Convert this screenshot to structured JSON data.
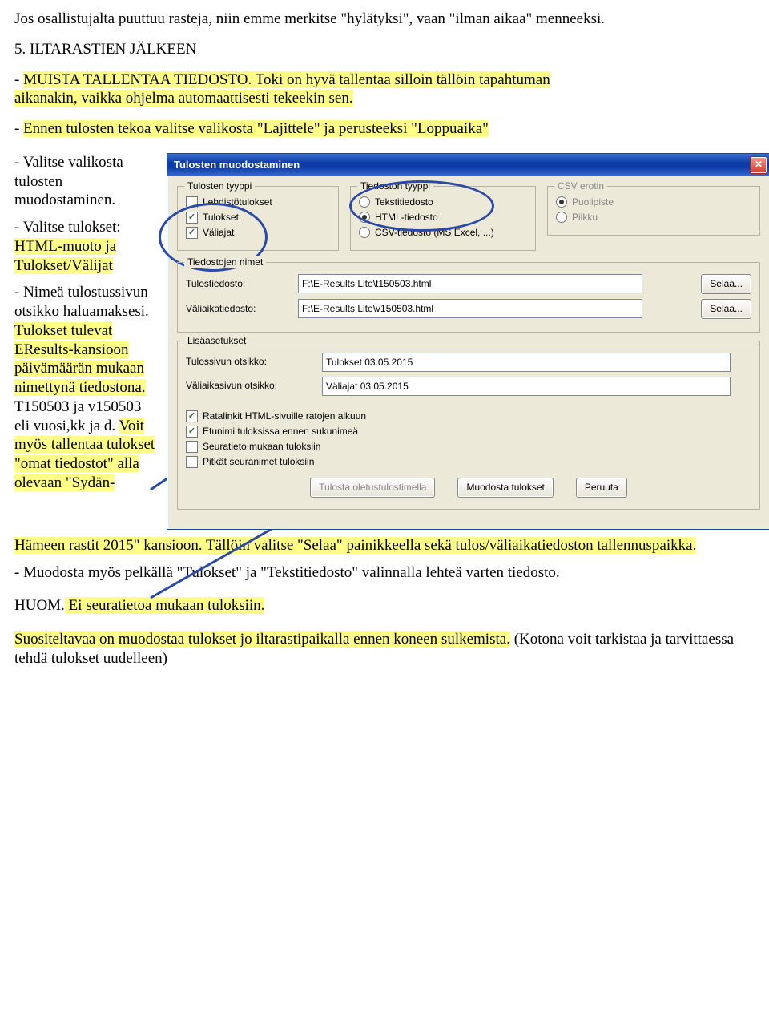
{
  "doc": {
    "intro": "Jos osallistujalta puuttuu rasteja, niin emme merkitse \"hylätyksi\", vaan \"ilman aikaa\" menneeksi.",
    "section_num": "5.  ILTARASTIEN JÄLKEEN",
    "muista_pre": "- ",
    "muista_hl": "MUISTA TALLENTAA TIEDOSTO.",
    "muista_post1_hl": " Toki on hyvä tallentaa silloin tällöin tapahtuman",
    "muista_line2_hl": "aikanakin, vaikka ohjelma automaattisesti tekeekin sen.",
    "ennen_pre": "-  ",
    "ennen_hl": "Ennen tulosten tekoa valitse valikosta \"Lajittele\" ja perusteeksi \"Loppuaika\"",
    "left": {
      "a1": "-  Valitse valikosta tulosten muodostaminen.",
      "b1_pre": "-  Valitse tulokset: ",
      "b1_hl": "HTML-muoto ja Tulokset/Välijat",
      "c_plain1": "-  Nimeä tulostussivun otsikko haluamaksesi. ",
      "c_hl1": "Tulokset tulevat EResults-kansioon päivämäärän mukaan nimettynä tiedostona.",
      "c_plain2": " T150503 ja v150503 eli vuosi,kk ja d. ",
      "c_hl2": "Voit myös tallentaa tulokset \"omat tiedostot\" alla olevaan \"Sydän-"
    },
    "after": {
      "cont_hl": "Hämeen rastit 2015\" kansioon. Tällöin valitse \"Selaa\" painikkeella sekä tulos/väliaikatiedoston tallennuspaikka.",
      "line2": "-  Muodosta myös pelkällä \"Tulokset\" ja \"Tekstitiedosto\" valinnalla lehteä varten tiedosto.",
      "huom_pre": "HUOM.",
      "huom_hl": "  Ei seuratietoa mukaan tuloksiin.",
      "suos_hl": "Suositeltavaa on muodostaa tulokset jo iltarastipaikalla ennen koneen sulkemista.",
      "suos_post": "   (Kotona voit tarkistaa ja tarvittaessa tehdä tulokset uudelleen)"
    }
  },
  "dialog": {
    "title": "Tulosten muodostaminen",
    "fs_tt": "Tulosten tyyppi",
    "tt_lehd": "Lehdistötulokset",
    "tt_tul": "Tulokset",
    "tt_vali": "Väliajat",
    "fs_td": "Tiedoston tyyppi",
    "td_teksti": "Tekstitiedosto",
    "td_html": "HTML-tiedosto",
    "td_csv": "CSV-tiedosto (MS Excel, ...)",
    "fs_csv": "CSV erotin",
    "csv_pp": "Puolipiste",
    "csv_pk": "Pilkku",
    "fs_names": "Tiedostojen nimet",
    "lbl_tulos": "Tulostiedosto:",
    "val_tulos": "F:\\E-Results Lite\\t150503.html",
    "lbl_vali": "Väliaikatiedosto:",
    "val_vali": "F:\\E-Results Lite\\v150503.html",
    "btn_selaa": "Selaa...",
    "fs_lisa": "Lisäasetukset",
    "lbl_otsikko": "Tulossivun otsikko:",
    "val_otsikko": "Tulokset 03.05.2015",
    "lbl_votsikko": "Väliaikasivun otsikko:",
    "val_votsikko": "Väliajat 03.05.2015",
    "c_rata": "Ratalinkit HTML-sivuille ratojen alkuun",
    "c_etu": "Etunimi tuloksissa ennen sukunimeä",
    "c_seura": "Seuratieto mukaan tuloksiin",
    "c_pitka": "Pitkät seuranimet tuloksiin",
    "btn_oletus": "Tulosta oletustulostimella",
    "btn_muod": "Muodosta tulokset",
    "btn_peru": "Peruuta"
  }
}
